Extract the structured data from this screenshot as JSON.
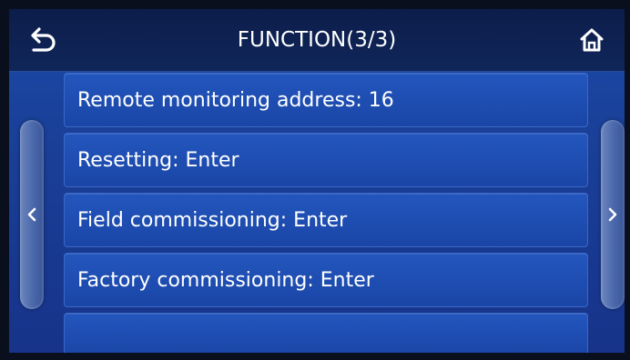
{
  "header": {
    "title": "FUNCTION(3/3)",
    "back_icon": "back-arrow-icon",
    "home_icon": "home-icon"
  },
  "nav": {
    "prev_glyph": "<",
    "next_glyph": ">"
  },
  "rows": [
    {
      "label": "Remote monitoring address: 16"
    },
    {
      "label": "Resetting: Enter"
    },
    {
      "label": "Field commissioning: Enter"
    },
    {
      "label": "Factory commissioning: Enter"
    },
    {
      "label": ""
    }
  ],
  "colors": {
    "header_bg": "#0c1d4a",
    "panel_bg": "#1a4aa8",
    "row_bg": "#2356bd",
    "text": "#ffffff"
  }
}
